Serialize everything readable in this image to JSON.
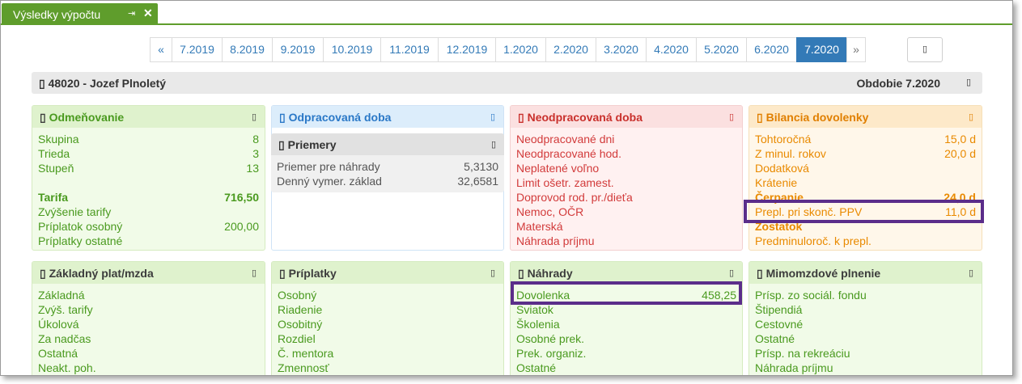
{
  "window": {
    "tab_title": "Výsledky výpočtu",
    "pin_icon": "pin-icon",
    "close_icon": "close-icon"
  },
  "pager": {
    "prev": "«",
    "next": "»",
    "items": [
      "7.2019",
      "8.2019",
      "9.2019",
      "10.2019",
      "11.2019",
      "12.2019",
      "1.2020",
      "2.2020",
      "3.2020",
      "4.2020",
      "5.2020",
      "6.2020",
      "7.2020"
    ],
    "active": "7.2020",
    "active_color": "#337ab7"
  },
  "toolbar": {
    "action_icon": "print-icon"
  },
  "employee": {
    "label": "48020 - Jozef Plnoletý",
    "period": "Obdobie 7.2020",
    "icon": "user-icon"
  },
  "odmenovanie": {
    "title": "Odmeňovanie",
    "rows": [
      {
        "label": "Skupina",
        "value": "8"
      },
      {
        "label": "Trieda",
        "value": "3"
      },
      {
        "label": "Stupeň",
        "value": "13"
      },
      {
        "label": "Tarifa",
        "value": "716,50"
      },
      {
        "label": "Zvýšenie tarify",
        "value": ""
      },
      {
        "label": "Príplatok osobný",
        "value": "200,00"
      },
      {
        "label": "Príplatky ostatné",
        "value": ""
      }
    ]
  },
  "odpracovana": {
    "title": "Odpracovaná doba"
  },
  "priemery": {
    "title": "Priemery",
    "rows": [
      {
        "label": "Priemer pre náhrady",
        "value": "5,3130"
      },
      {
        "label": "Denný vymer. základ",
        "value": "32,6581"
      }
    ]
  },
  "neodpracovana": {
    "title": "Neodpracovaná doba",
    "rows": [
      "Neodpracované dni",
      "Neodpracované hod.",
      "Neplatené voľno",
      "Limit ošetr. zamest.",
      "Doprovod rod. pr./dieťa",
      "Nemoc, OČR",
      "Materská",
      "Náhrada príjmu"
    ]
  },
  "bilancia": {
    "title": "Bilancia dovolenky",
    "rows": [
      {
        "label": "Tohtoročná",
        "value": "15,0 d"
      },
      {
        "label": "Z minul. rokov",
        "value": "20,0 d"
      },
      {
        "label": "Dodatková",
        "value": ""
      },
      {
        "label": "Krátenie",
        "value": ""
      },
      {
        "label": "Čerpanie",
        "value": "24,0 d"
      },
      {
        "label": "Prepl. pri skonč. PPV",
        "value": "11,0 d"
      },
      {
        "label": "Zostatok",
        "value": ""
      },
      {
        "label": "Predminuloroč. k prepl.",
        "value": ""
      }
    ]
  },
  "zakladny": {
    "title": "Základný plat/mzda",
    "rows": [
      "Základná",
      "Zvýš. tarify",
      "Úkolová",
      "Za nadčas",
      "Ostatná",
      "Neakt. poh."
    ]
  },
  "priplatky": {
    "title": "Príplatky",
    "rows": [
      "Osobný",
      "Riadenie",
      "Osobitný",
      "Rozdiel",
      "Č. mentora",
      "Zmennosť"
    ]
  },
  "nahrady": {
    "title": "Náhrady",
    "rows": [
      {
        "label": "Dovolenka",
        "value": "458,25"
      },
      {
        "label": "Sviatok",
        "value": ""
      },
      {
        "label": "Školenia",
        "value": ""
      },
      {
        "label": "Osobné prek.",
        "value": ""
      },
      {
        "label": "Prek. organiz.",
        "value": ""
      },
      {
        "label": "Ostatné",
        "value": ""
      }
    ]
  },
  "mimomzdove": {
    "title": "Mimomzdové plnenie",
    "rows": [
      "Prísp. zo sociál. fondu",
      "Štipendiá",
      "Cestovné",
      "Ostatné",
      "Prísp. na rekreáciu",
      "Náhrada príjmu"
    ]
  },
  "colors": {
    "green": "#4a9a1f",
    "blue": "#2a78c7",
    "red": "#d23b3b",
    "orange": "#e98a00",
    "highlight": "#5b2d8a"
  }
}
